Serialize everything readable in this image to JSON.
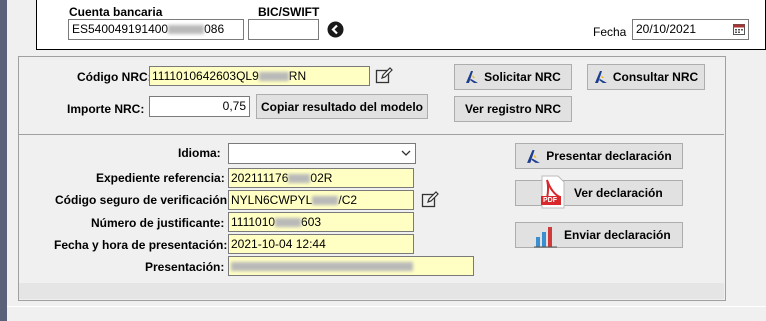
{
  "bank": {
    "account_label": "Cuenta bancaria",
    "bic_label": "BIC/SWIFT",
    "account_value_start": "ES540049191400",
    "account_value_end": "086",
    "bic_value": ""
  },
  "fecha": {
    "label": "Fecha",
    "value": "20/10/2021"
  },
  "nrc": {
    "codigo_label": "Código NRC:",
    "codigo_value_start": "1111010642603QL9",
    "codigo_value_end": "RN",
    "importe_label": "Importe NRC:",
    "importe_value": "0,75",
    "copiar_button": "Copiar resultado del modelo",
    "solicitar_button": "Solicitar NRC",
    "consultar_button": "Consultar NRC",
    "registro_button": "Ver registro NRC"
  },
  "declaracion": {
    "idioma_label": "Idioma:",
    "idioma_value": "",
    "expediente_label": "Expediente referencia:",
    "expediente_value_start": "202111176",
    "expediente_value_end": "02R",
    "csv_label": "Código seguro de verificación:",
    "csv_value_start": "NYLN6CWPYL",
    "csv_value_end": "/C2",
    "justificante_label": "Número de justificante:",
    "justificante_value_start": "1111010",
    "justificante_value_end": "603",
    "fecha_hora_label": "Fecha y hora de presentación:",
    "fecha_hora_value": "2021-10-04  12:44",
    "presentacion_label": "Presentación:",
    "presentar_button": "Presentar declaración",
    "ver_button": "Ver declaración",
    "enviar_button": "Enviar declaración",
    "pdf_badge": "PDF"
  },
  "colors": {
    "readonly_bg": "#ffffc4",
    "button_bg": "#e1e1e1",
    "aeat_blue": "#1d3d8f",
    "aeat_yellow": "#f2b400",
    "pdf_red": "#d9282b"
  }
}
